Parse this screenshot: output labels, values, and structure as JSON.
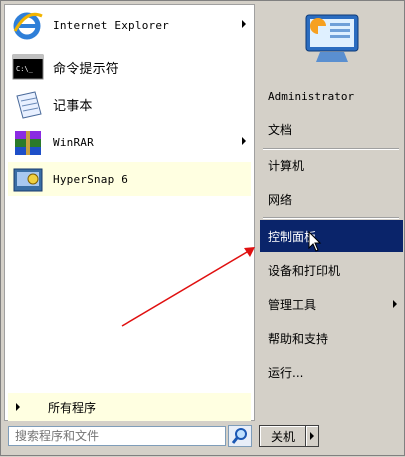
{
  "pinned_programs": [
    {
      "name": "internet-explorer",
      "label": "Internet Explorer",
      "icon": "ie-icon",
      "has_submenu": true
    },
    {
      "name": "cmd",
      "label": "命令提示符",
      "icon": "cmd-icon",
      "has_submenu": false
    },
    {
      "name": "notepad",
      "label": "记事本",
      "icon": "notepad-icon",
      "has_submenu": false
    },
    {
      "name": "winrar",
      "label": "WinRAR",
      "icon": "winrar-icon",
      "has_submenu": true
    },
    {
      "name": "hypersnap",
      "label": "HyperSnap 6",
      "icon": "hypersnap-icon",
      "has_submenu": false,
      "highlighted": true
    }
  ],
  "cmd_icon_text": "C:\\_",
  "all_programs_label": "所有程序",
  "right_items": [
    {
      "name": "administrator",
      "label": "Administrator"
    },
    {
      "name": "documents",
      "label": "文档"
    },
    {
      "name": "computer",
      "label": "计算机"
    },
    {
      "name": "network",
      "label": "网络"
    },
    {
      "name": "control-panel",
      "label": "控制面板",
      "selected": true
    },
    {
      "name": "devices-printers",
      "label": "设备和打印机"
    },
    {
      "name": "admin-tools",
      "label": "管理工具",
      "has_submenu": true
    },
    {
      "name": "help-support",
      "label": "帮助和支持"
    },
    {
      "name": "run",
      "label": "运行..."
    }
  ],
  "search": {
    "placeholder": "搜索程序和文件",
    "value": ""
  },
  "shutdown_label": "关机",
  "colors": {
    "selected_bg": "#0a246a",
    "highlight_bg": "#ffffe1",
    "annotation_arrow": "#e01010"
  }
}
